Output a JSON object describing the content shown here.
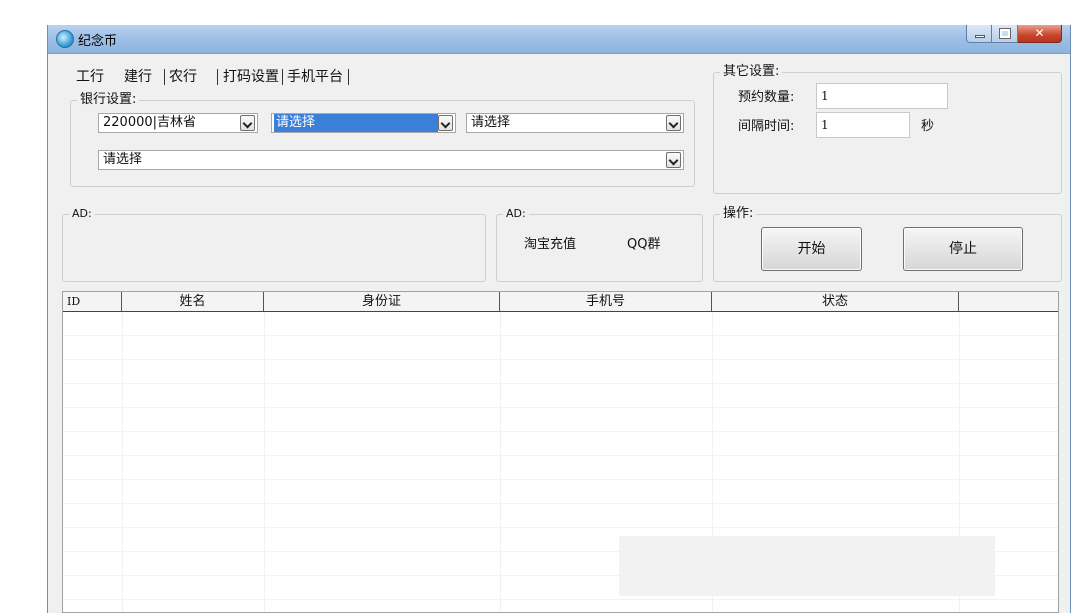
{
  "window": {
    "title": "纪念币"
  },
  "tabs": [
    {
      "label": "工行"
    },
    {
      "label": "建行"
    },
    {
      "label": "农行"
    },
    {
      "label": "打码设置"
    },
    {
      "label": "手机平台"
    }
  ],
  "bank_settings": {
    "legend": "银行设置:",
    "province_value": "220000|吉林省",
    "city_value": "请选择",
    "district_value": "请选择",
    "branch_value": "请选择"
  },
  "other_settings": {
    "legend": "其它设置:",
    "quantity_label": "预约数量:",
    "quantity_value": "1",
    "interval_label": "间隔时间:",
    "interval_value": "1",
    "interval_unit": "秒"
  },
  "ad_left": {
    "legend": "AD:"
  },
  "ad_right": {
    "legend": "AD:",
    "taobao": "淘宝充值",
    "qq": "QQ群"
  },
  "operations": {
    "legend": "操作:",
    "start_label": "开始",
    "stop_label": "停止"
  },
  "grid": {
    "columns": [
      "ID",
      "姓名",
      "身份证",
      "手机号",
      "状态"
    ]
  }
}
